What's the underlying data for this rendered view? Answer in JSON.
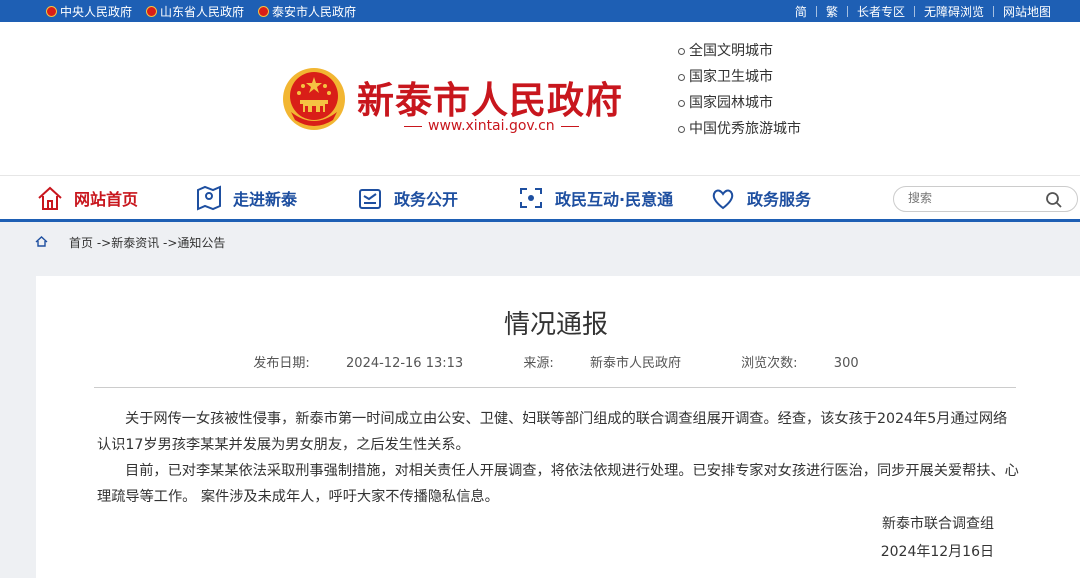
{
  "topbar": {
    "links": [
      "中央人民政府",
      "山东省人民政府",
      "泰安市人民政府"
    ],
    "right": [
      "简",
      "繁",
      "长者专区",
      "无障碍浏览",
      "网站地图"
    ]
  },
  "header": {
    "title": "新泰市人民政府",
    "url": "www.xintai.gov.cn",
    "honors": [
      "全国文明城市",
      "国家卫生城市",
      "国家园林城市",
      "中国优秀旅游城市"
    ]
  },
  "nav": {
    "items": [
      "网站首页",
      "走进新泰",
      "政务公开",
      "政民互动·民意通",
      "政务服务"
    ],
    "search_placeholder": "搜索"
  },
  "breadcrumb": {
    "path": "首页 ->新泰资讯 ->通知公告"
  },
  "article": {
    "title": "情况通报",
    "date_label": "发布日期:",
    "date": "2024-12-16 13:13",
    "source_label": "来源:",
    "source": "新泰市人民政府",
    "views_label": "浏览次数:",
    "views": "300",
    "paragraphs": [
      "关于网传一女孩被性侵事，新泰市第一时间成立由公安、卫健、妇联等部门组成的联合调查组展开调查。经查，该女孩于2024年5月通过网络认识17岁男孩李某某并发展为男女朋友，之后发生性关系。",
      "目前，已对李某某依法采取刑事强制措施，对相关责任人开展调查，将依法依规进行处理。已安排专家对女孩进行医治，同步开展关爱帮扶、心理疏导等工作。 案件涉及未成年人，呼吁大家不传播隐私信息。"
    ],
    "signer": "新泰市联合调查组",
    "sign_date": "2024年12月16日"
  },
  "colors": {
    "brand_blue": "#1e5fb4",
    "brand_red": "#c8161d"
  }
}
